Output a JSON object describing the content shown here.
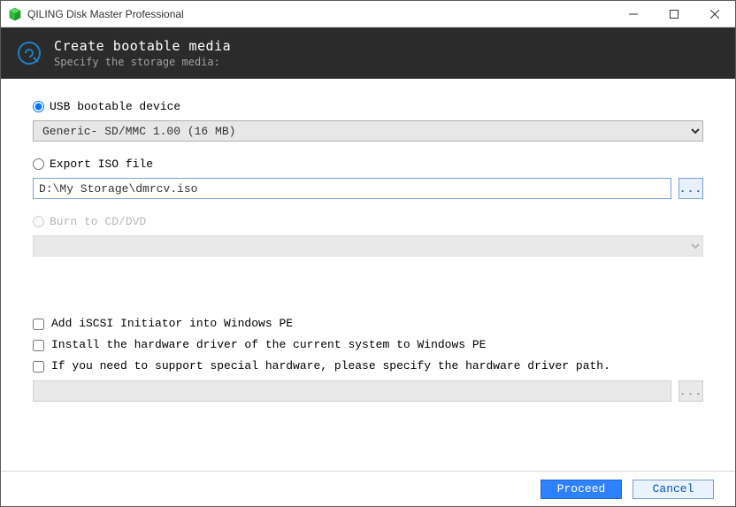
{
  "titlebar": {
    "title": "QILING Disk Master Professional"
  },
  "header": {
    "title": "Create bootable media",
    "subtitle": "Specify the storage media:"
  },
  "options": {
    "usb": {
      "label": "USB bootable device",
      "selected": "Generic- SD/MMC 1.00 (16 MB)"
    },
    "iso": {
      "label": "Export ISO file",
      "path": "D:\\My Storage\\dmrcv.iso",
      "browse": "..."
    },
    "burn": {
      "label": "Burn to CD/DVD"
    }
  },
  "checks": {
    "iscsi": "Add iSCSI Initiator into Windows PE",
    "driver_current": "Install the hardware driver of the current system to Windows PE",
    "driver_path": "If you need to support special hardware, please specify the hardware driver path.",
    "driver_browse": "..."
  },
  "footer": {
    "proceed": "Proceed",
    "cancel": "Cancel"
  }
}
